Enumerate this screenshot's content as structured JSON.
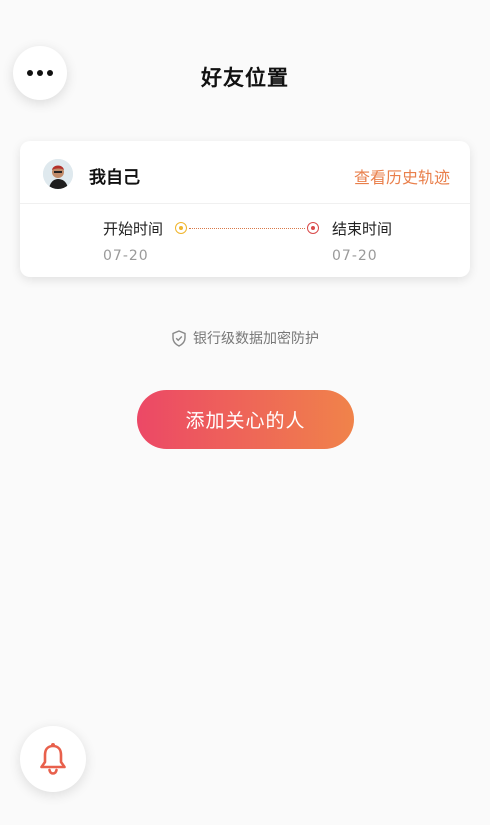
{
  "header": {
    "title": "好友位置",
    "menu_icon": "more-dots-icon"
  },
  "card": {
    "user_name": "我自己",
    "history_link": "查看历史轨迹",
    "start_label": "开始时间",
    "start_date": "07-20",
    "end_label": "结束时间",
    "end_date": "07-20"
  },
  "security_text": "银行级数据加密防护",
  "add_button_label": "添加关心的人",
  "colors": {
    "accent": "#e97f4b",
    "gradient_start": "#ec4866",
    "gradient_end": "#f0834a",
    "bell": "#e8604c"
  }
}
